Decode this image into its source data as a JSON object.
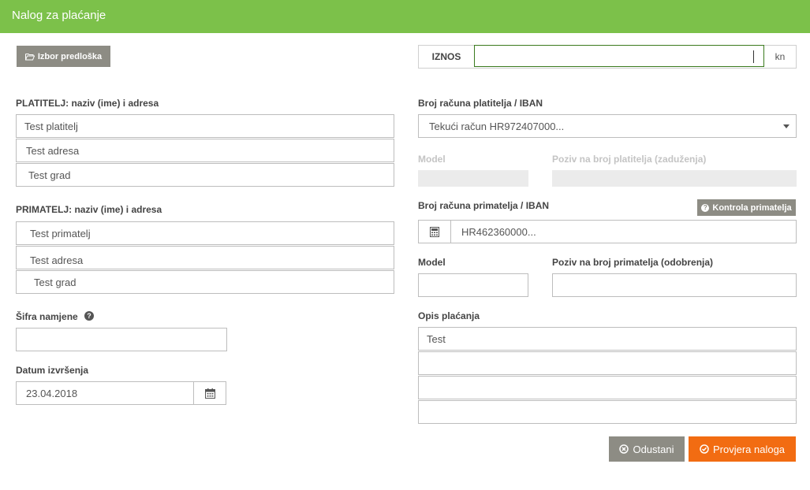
{
  "header": {
    "title": "Nalog za plaćanje"
  },
  "toolbar": {
    "template_button_label": "Izbor predloška"
  },
  "amount": {
    "label": "IZNOS",
    "value": "",
    "currency": "kn"
  },
  "payer": {
    "section_label": "PLATITELJ: naziv (ime) i adresa",
    "name": "Test platitelj",
    "address": "Test adresa",
    "city": "Test grad"
  },
  "payer_account": {
    "label": "Broj računa platitelja / IBAN",
    "selected": "Tekući račun HR972407000..."
  },
  "payer_model": {
    "label": "Model",
    "value": ""
  },
  "payer_reference": {
    "label": "Poziv na broj platitelja (zaduženja)",
    "value": ""
  },
  "recipient": {
    "section_label": "PRIMATELJ: naziv (ime) i adresa",
    "name": "Test primatelj",
    "address": "Test adresa",
    "city": "Test grad"
  },
  "recipient_account": {
    "label": "Broj računa primatelja / IBAN",
    "check_button_label": "Kontrola primatelja",
    "value": "HR462360000..."
  },
  "recipient_model": {
    "label": "Model",
    "value": ""
  },
  "recipient_reference": {
    "label": "Poziv na broj primatelja (odobrenja)",
    "value": ""
  },
  "purpose_code": {
    "label": "Šifra namjene",
    "value": ""
  },
  "execution_date": {
    "label": "Datum izvršenja",
    "value": "23.04.2018"
  },
  "description": {
    "label": "Opis plaćanja",
    "lines": [
      "Test",
      "",
      "",
      ""
    ]
  },
  "actions": {
    "cancel_label": "Odustani",
    "check_label": "Provjera naloga"
  },
  "colors": {
    "header": "#7cc14a",
    "primary_button": "#f26c12",
    "secondary_button": "#8d8c84"
  }
}
